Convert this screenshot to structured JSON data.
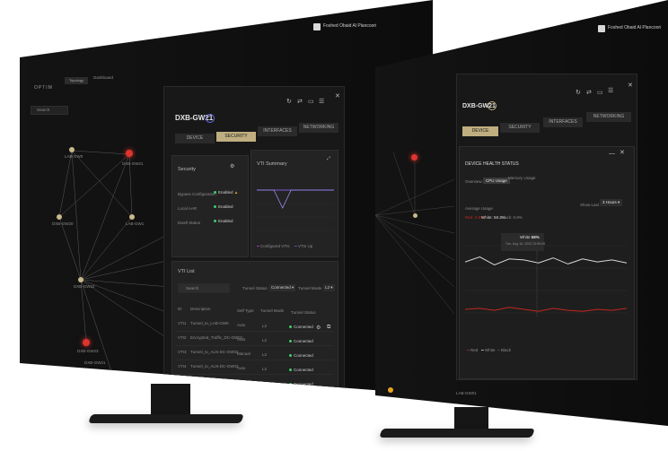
{
  "left_screen": {
    "brand": "OPTIM",
    "nav_tabs": [
      "Topology",
      "Dashboard"
    ],
    "search_placeholder": "Search",
    "user_name": "Foshed Obaid Al Plancoori",
    "topology_nodes": [
      "LAB-GW0",
      "DXB-GW21",
      "DXB-GW20",
      "LAB-GW1",
      "DXB-GW22",
      "DXB-GW23",
      "DXB-GW21",
      "DXB-GW24"
    ],
    "device_title": "DXB-GW21",
    "tabs": [
      "DEVICE",
      "SECURITY",
      "INTERFACES",
      "NETWORKING"
    ],
    "active_tab": "SECURITY",
    "security": {
      "title": "Security",
      "rows": [
        {
          "label": "Bypass Configuration",
          "value": "Enabled",
          "warn": true
        },
        {
          "label": "Local AAR",
          "value": "Enabled",
          "warn": false
        },
        {
          "label": "Dwell Status",
          "value": "Enabled",
          "warn": false
        }
      ]
    },
    "vti_summary": {
      "title": "VTI Summary",
      "legend": [
        "Configured VTIs",
        "VTIs Up"
      ]
    },
    "vti_list": {
      "title": "VTI List",
      "search_placeholder": "Search",
      "filters": [
        {
          "label": "Tunnel Status",
          "value": "Connected"
        },
        {
          "label": "Tunnel Mode",
          "value": "L2"
        }
      ],
      "columns": [
        "ID",
        "Description",
        "Self Type",
        "Tunnel Mode",
        "Tunnel Status"
      ],
      "rows": [
        {
          "id": "VTI1",
          "desc": "Tunnel_to_LAB-GW0",
          "type": "Auto",
          "mode": "L2",
          "status": "Connected"
        },
        {
          "id": "VTI2",
          "desc": "Encrypted_Traffic_DC-GW01",
          "type": "Auto",
          "mode": "L2",
          "status": "Connected"
        },
        {
          "id": "VTI3",
          "desc": "Tunnel_to_ALN-DC-GW02",
          "type": "Manual",
          "mode": "L2",
          "status": "Connected"
        },
        {
          "id": "VTI4",
          "desc": "Tunnel_to_ALN-DC-GW03",
          "type": "Auto",
          "mode": "L2",
          "status": "Connected"
        },
        {
          "id": "VTI5",
          "desc": "Tunnel_to_ALN-GW03",
          "type": "Manual",
          "mode": "L2",
          "status": "Connected"
        }
      ]
    }
  },
  "right_screen": {
    "user_name": "Foshed Obaid Al Plancoori",
    "device_title": "DXB-GW21",
    "tabs": [
      "DEVICE",
      "SECURITY",
      "INTERFACES",
      "NETWORKING"
    ],
    "active_tab": "DEVICE",
    "health": {
      "title": "DEVICE HEALTH STATUS",
      "subtabs": [
        "Overview",
        "CPU Usage",
        "Memory Usage"
      ],
      "active_subtab": "CPU Usage",
      "avg_label": "Average Usage",
      "avg_values": [
        "Red: 2.8%",
        "White: 58.2%",
        "Black: 0.9%"
      ],
      "show_last_label": "Show Last",
      "show_last_value": "3 Hours",
      "tooltip_title": "White",
      "tooltip_value": "58%",
      "tooltip_date": "Tue, Aug 16, 2022 23:59:59",
      "legend": [
        "Red",
        "White",
        "Black"
      ]
    },
    "bottom_node": "LAB-GW01"
  },
  "colors": {
    "accent": "#bfae80",
    "ok": "#3ccf6a",
    "alert": "#e0342f",
    "warn": "#e6a61f",
    "line_purple": "#7b5bdc",
    "line_white": "#d8d8d8",
    "line_red": "#c4271f"
  },
  "chart_data": [
    {
      "type": "line",
      "series": [
        {
          "name": "Configured VTIs",
          "values": [
            6,
            6,
            6,
            6,
            6,
            6,
            6,
            6,
            6,
            6
          ]
        },
        {
          "name": "VTIs Up",
          "values": [
            6,
            6,
            6,
            2,
            6,
            6,
            6,
            6,
            6,
            6
          ]
        }
      ]
    },
    {
      "type": "line",
      "series": [
        {
          "name": "White",
          "values": [
            55,
            60,
            52,
            58,
            57,
            54,
            59,
            53,
            58,
            55,
            57,
            54
          ]
        },
        {
          "name": "Red",
          "values": [
            8,
            9,
            7,
            10,
            8,
            6,
            9,
            7,
            6,
            8,
            7,
            9
          ]
        }
      ]
    }
  ]
}
